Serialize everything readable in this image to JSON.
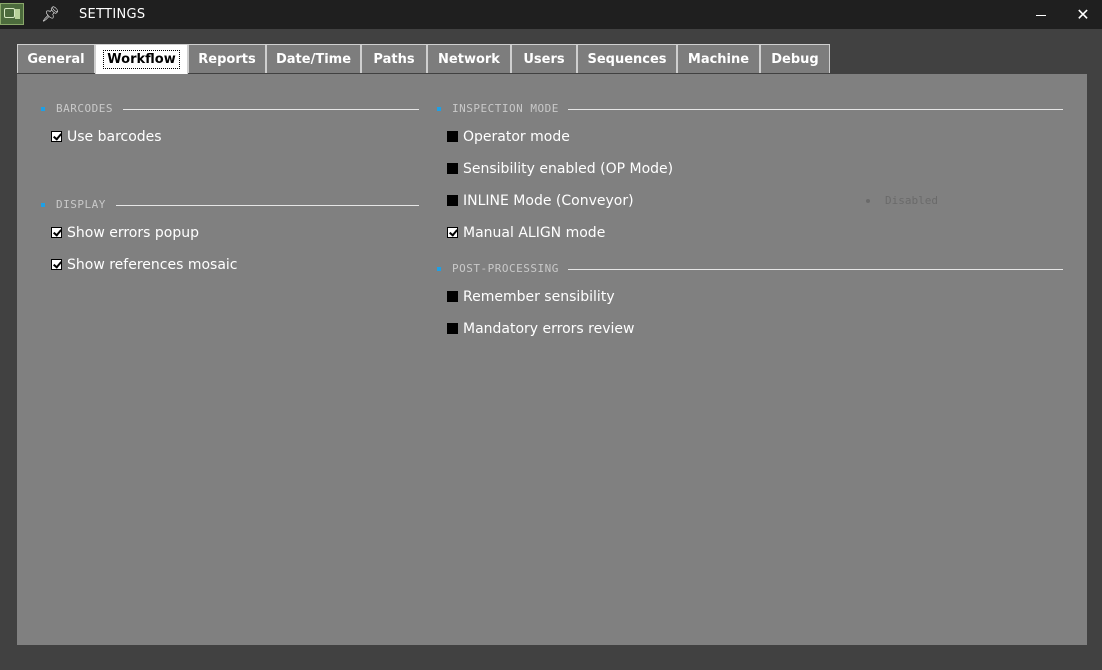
{
  "window": {
    "title": "SETTINGS",
    "minimize_glyph": "",
    "close_glyph": "✕"
  },
  "tabs": [
    {
      "label": "General",
      "active": false
    },
    {
      "label": "Workflow",
      "active": true
    },
    {
      "label": "Reports",
      "active": false
    },
    {
      "label": "Date/Time",
      "active": false
    },
    {
      "label": "Paths",
      "active": false
    },
    {
      "label": "Network",
      "active": false
    },
    {
      "label": "Users",
      "active": false
    },
    {
      "label": "Sequences",
      "active": false
    },
    {
      "label": "Machine",
      "active": false
    },
    {
      "label": "Debug",
      "active": false
    }
  ],
  "sections": {
    "barcodes": {
      "title": "BARCODES",
      "items": [
        {
          "label": "Use barcodes",
          "checked": true
        }
      ]
    },
    "display": {
      "title": "DISPLAY",
      "items": [
        {
          "label": "Show errors popup",
          "checked": true
        },
        {
          "label": "Show references mosaic",
          "checked": true
        }
      ]
    },
    "inspection_mode": {
      "title": "INSPECTION MODE",
      "items": [
        {
          "label": "Operator mode",
          "checked": false
        },
        {
          "label": "Sensibility enabled (OP Mode)",
          "checked": false
        },
        {
          "label": "INLINE Mode (Conveyor)",
          "checked": false
        },
        {
          "label": "Manual ALIGN mode",
          "checked": true
        }
      ]
    },
    "post_processing": {
      "title": "POST-PROCESSING",
      "items": [
        {
          "label": "Remember sensibility",
          "checked": false
        },
        {
          "label": "Mandatory errors review",
          "checked": false
        }
      ]
    }
  },
  "inline_status": "Disabled",
  "colors": {
    "accent": "#1ea0e6",
    "panel": "#808080",
    "titlebar": "#1f1f1f"
  }
}
